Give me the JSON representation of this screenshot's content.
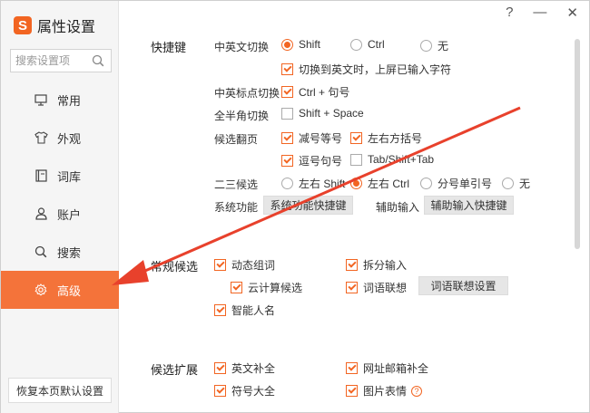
{
  "app": {
    "title": "属性设置",
    "logo_letter": "S"
  },
  "title_controls": {
    "help": "?",
    "minimize": "—",
    "close": "✕"
  },
  "search": {
    "placeholder": "搜索设置项"
  },
  "nav": [
    {
      "label": "常用",
      "icon": "monitor-icon"
    },
    {
      "label": "外观",
      "icon": "shirt-icon"
    },
    {
      "label": "词库",
      "icon": "book-icon"
    },
    {
      "label": "账户",
      "icon": "user-icon"
    },
    {
      "label": "搜索",
      "icon": "search-icon"
    },
    {
      "label": "高级",
      "icon": "gear-icon",
      "active": true
    }
  ],
  "reset_label": "恢复本页默认设置",
  "shortcuts": {
    "section": "快捷键",
    "cn_en_switch": {
      "label": "中英文切换",
      "opt_shift": "Shift",
      "opt_ctrl": "Ctrl",
      "opt_none": "无",
      "switch_commit": "切换到英文时，上屏已输入字符"
    },
    "punct_switch": {
      "label": "中英标点切换",
      "opt": "Ctrl + 句号"
    },
    "width_switch": {
      "label": "全半角切换",
      "opt": "Shift + Space"
    },
    "page_turn": {
      "label": "候选翻页",
      "minus_equal": "减号等号",
      "brackets": "左右方括号",
      "comma_period": "逗号句号",
      "tab": "Tab/Shift+Tab"
    },
    "second_third": {
      "label": "二三候选",
      "opt_shift": "左右 Shift",
      "opt_ctrl": "左右 Ctrl",
      "opt_semicolon": "分号单引号",
      "opt_none": "无"
    },
    "system_func": {
      "label": "系统功能",
      "button": "系统功能快捷键"
    },
    "aux_input": {
      "label": "辅助输入",
      "button": "辅助输入快捷键"
    }
  },
  "candidates": {
    "section": "常规候选",
    "dynamic_words": "动态组词",
    "split_input": "拆分输入",
    "cloud_candidates": "云计算候选",
    "word_association": "词语联想",
    "word_assoc_button": "词语联想设置",
    "smart_names": "智能人名"
  },
  "extension": {
    "section": "候选扩展",
    "english_complete": "英文补全",
    "email_complete": "网址邮箱补全",
    "symbols": "符号大全",
    "emoji_images": "图片表情"
  },
  "colors": {
    "accent": "#f26522",
    "active_nav": "#f4733a",
    "arrow": "#e8412c"
  }
}
